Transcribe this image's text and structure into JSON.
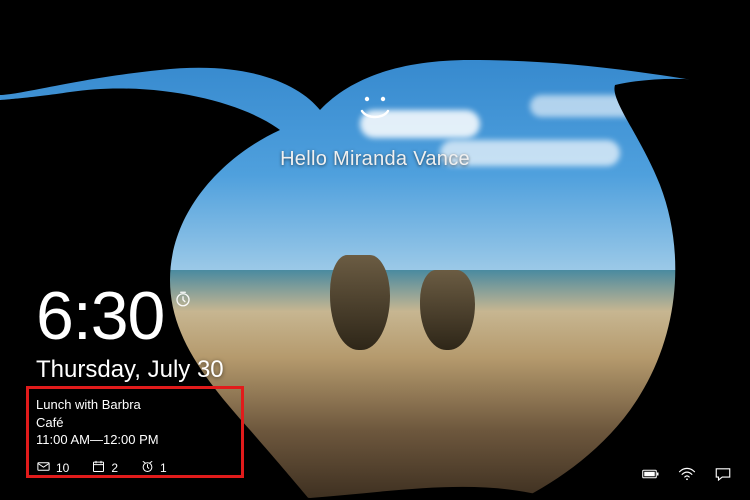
{
  "hello": {
    "greeting": "Hello Miranda Vance"
  },
  "clock": {
    "time": "6:30",
    "date": "Thursday, July 30"
  },
  "calendar_widget": {
    "title": "Lunch with Barbra",
    "location": "Café",
    "time_range": "11:00 AM—12:00 PM"
  },
  "status": {
    "mail_count": "10",
    "calendar_count": "2",
    "alarm_count": "1"
  },
  "icons": {
    "smile": "smile-icon",
    "clock_small": "clock-icon",
    "mail": "mail-icon",
    "calendar": "calendar-icon",
    "alarm": "alarm-icon",
    "battery": "battery-icon",
    "wifi": "wifi-icon",
    "action_center": "action-center-icon"
  }
}
